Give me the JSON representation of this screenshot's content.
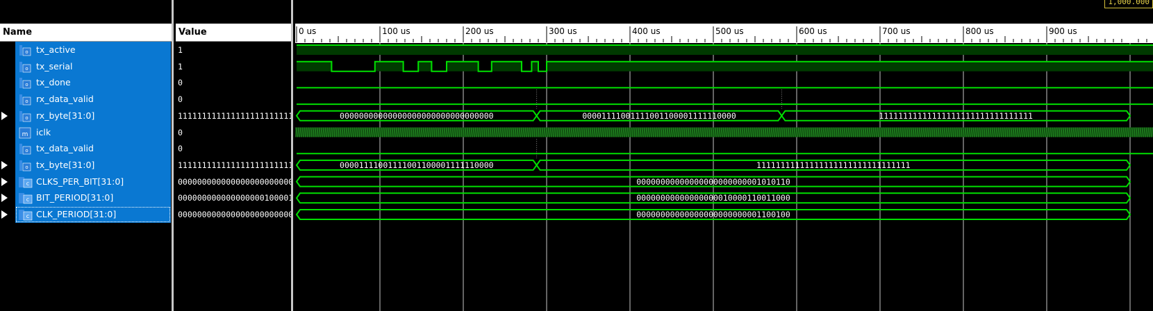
{
  "cursor_time": "1,000.000",
  "headers": {
    "name": "Name",
    "value": "Value"
  },
  "timeline": {
    "unit": "us",
    "ticks": [
      "0 us",
      "100 us",
      "200 us",
      "300 us",
      "400 us",
      "500 us",
      "600 us",
      "700 us",
      "800 us",
      "900 us"
    ]
  },
  "colors": {
    "wave": "#00e000",
    "wave_fill": "#003a00",
    "selection": "#0a78d2"
  },
  "signals": [
    {
      "name": "tx_active",
      "value": "1",
      "type": "bit",
      "expandable": false,
      "icon": "bit-signal-icon"
    },
    {
      "name": "tx_serial",
      "value": "1",
      "type": "bit",
      "expandable": false,
      "icon": "bit-signal-icon"
    },
    {
      "name": "tx_done",
      "value": "0",
      "type": "bit",
      "expandable": false,
      "icon": "bit-signal-icon"
    },
    {
      "name": "rx_data_valid",
      "value": "0",
      "type": "bit",
      "expandable": false,
      "icon": "bit-signal-icon"
    },
    {
      "name": "rx_byte[31:0]",
      "value": "11111111111111111111111111111111",
      "type": "bus",
      "expandable": true,
      "icon": "bus-signal-icon",
      "segments": [
        {
          "start": 0,
          "end": 288,
          "label": "00000000000000000000000000000000"
        },
        {
          "start": 288,
          "end": 582,
          "label": "00001111001111001100001111110000"
        },
        {
          "start": 582,
          "end": 1000,
          "label": "11111111111111111111111111111111"
        }
      ]
    },
    {
      "name": "iclk",
      "value": "0",
      "type": "clock",
      "expandable": false,
      "icon": "clock-signal-icon"
    },
    {
      "name": "tx_data_valid",
      "value": "0",
      "type": "bit",
      "expandable": false,
      "icon": "bit-signal-icon"
    },
    {
      "name": "tx_byte[31:0]",
      "value": "11111111111111111111111111111111",
      "type": "bus",
      "expandable": true,
      "icon": "bus-signal-icon",
      "segments": [
        {
          "start": 0,
          "end": 288,
          "label": "00001111001111001100001111110000"
        },
        {
          "start": 288,
          "end": 1000,
          "label": "11111111111111111111111111111111"
        }
      ]
    },
    {
      "name": "CLKS_PER_BIT[31:0]",
      "value": "00000000000000000000000001010110",
      "type": "bus",
      "expandable": true,
      "icon": "param-signal-icon",
      "segments": [
        {
          "start": 0,
          "end": 1000,
          "label": "00000000000000000000000001010110"
        }
      ]
    },
    {
      "name": "BIT_PERIOD[31:0]",
      "value": "00000000000000000010000110011000",
      "type": "bus",
      "expandable": true,
      "icon": "param-signal-icon",
      "segments": [
        {
          "start": 0,
          "end": 1000,
          "label": "00000000000000000010000110011000"
        }
      ]
    },
    {
      "name": "CLK_PERIOD[31:0]",
      "value": "00000000000000000000000001100100",
      "type": "bus",
      "expandable": true,
      "icon": "param-signal-icon",
      "segments": [
        {
          "start": 0,
          "end": 1000,
          "label": "00000000000000000000000001100100"
        }
      ]
    }
  ],
  "bit_waves": {
    "tx_active": [
      [
        0,
        1
      ]
    ],
    "tx_serial": [
      [
        0,
        1
      ],
      [
        42,
        0
      ],
      [
        94,
        1
      ],
      [
        128,
        0
      ],
      [
        146,
        1
      ],
      [
        162,
        0
      ],
      [
        180,
        1
      ],
      [
        218,
        0
      ],
      [
        234,
        1
      ],
      [
        270,
        0
      ],
      [
        282,
        1
      ],
      [
        290,
        0
      ],
      [
        300,
        1
      ]
    ],
    "tx_done": [
      [
        0,
        0
      ]
    ],
    "rx_data_valid": [
      [
        0,
        0
      ]
    ],
    "tx_data_valid": [
      [
        0,
        0
      ]
    ]
  }
}
